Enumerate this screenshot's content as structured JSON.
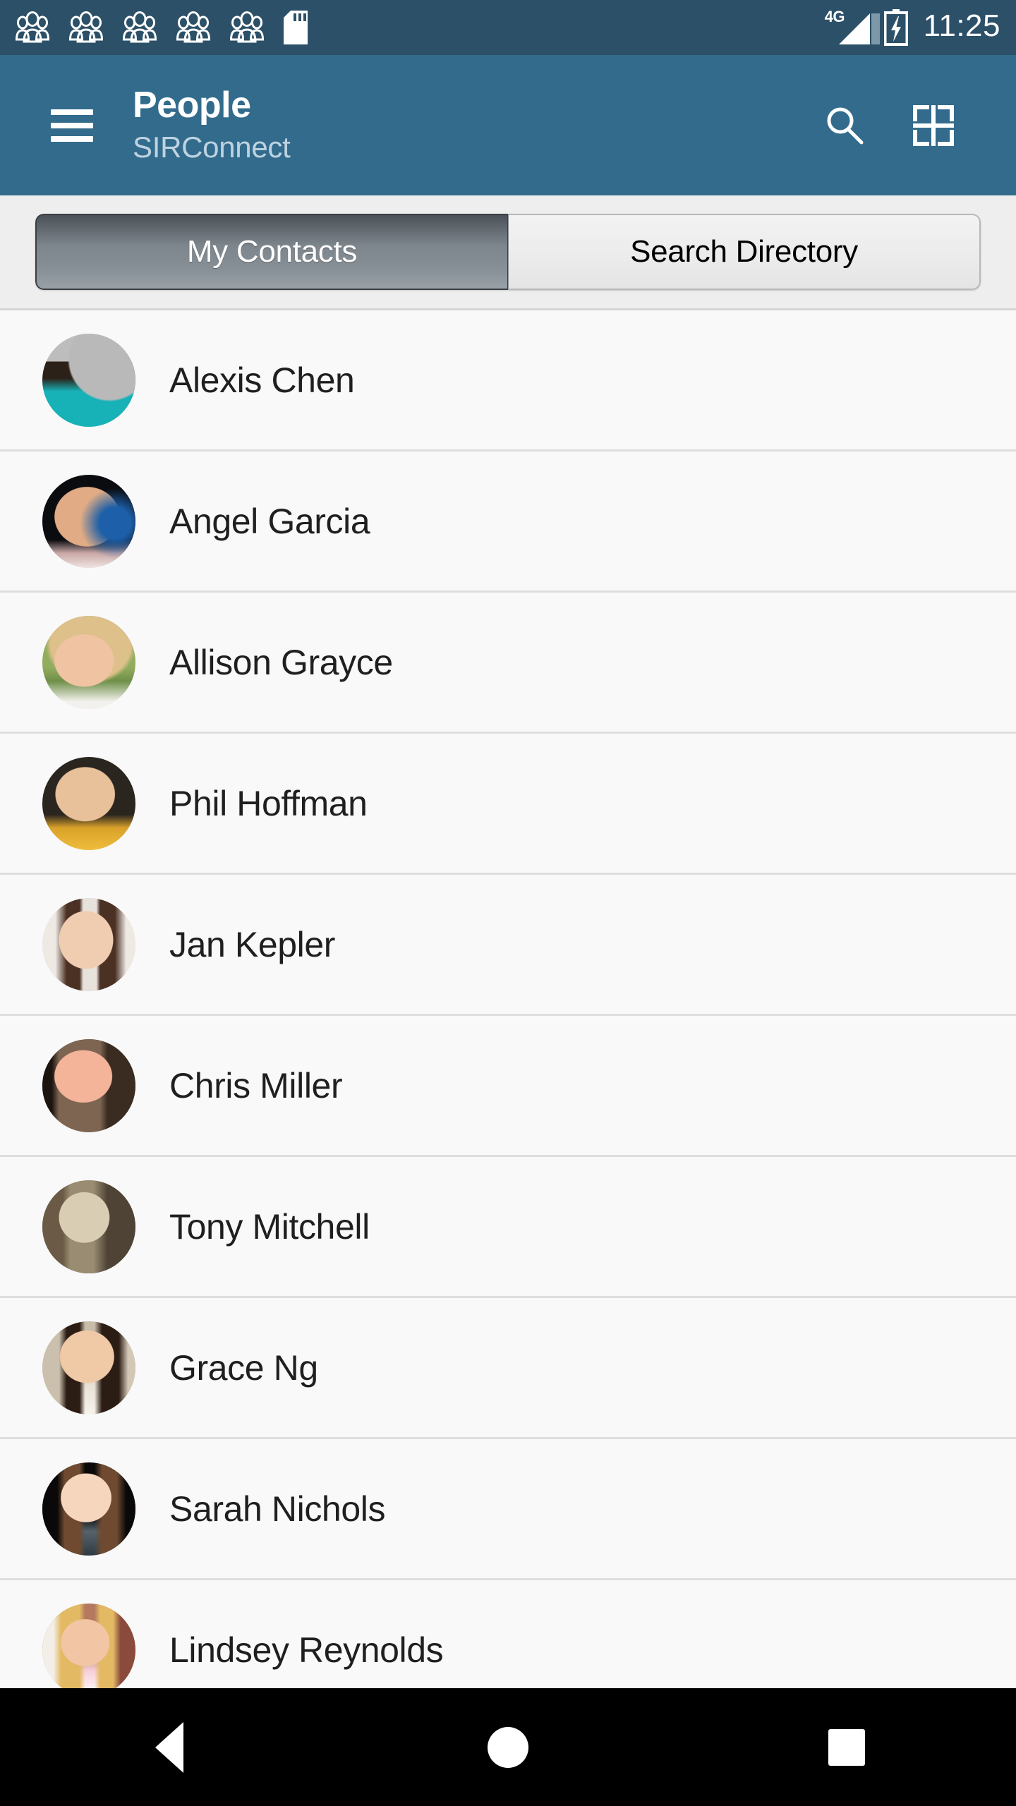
{
  "status_bar": {
    "notification_icons": [
      "people-group-icon",
      "people-group-icon",
      "people-group-icon",
      "people-group-icon",
      "people-group-icon",
      "sd-card-icon"
    ],
    "network_label": "4G",
    "signal_icon": "signal-bars-icon",
    "battery_icon": "battery-charging-icon",
    "time": "11:25",
    "background_color": "#2c5068"
  },
  "app_bar": {
    "menu_icon": "hamburger-menu-icon",
    "title": "People",
    "subtitle": "SIRConnect",
    "actions": [
      {
        "icon": "search-icon",
        "label": "Search"
      },
      {
        "icon": "add-grid-icon",
        "label": "Add"
      }
    ],
    "background_color": "#336b8c"
  },
  "tabs": {
    "items": [
      {
        "label": "My Contacts",
        "selected": true
      },
      {
        "label": "Search Directory",
        "selected": false
      }
    ]
  },
  "contacts": [
    {
      "name": "Alexis Chen",
      "avatar": "avatar-alexis-chen"
    },
    {
      "name": "Angel Garcia",
      "avatar": "avatar-angel-garcia"
    },
    {
      "name": "Allison Grayce",
      "avatar": "avatar-allison-grayce"
    },
    {
      "name": "Phil Hoffman",
      "avatar": "avatar-phil-hoffman"
    },
    {
      "name": "Jan Kepler",
      "avatar": "avatar-jan-kepler"
    },
    {
      "name": "Chris Miller",
      "avatar": "avatar-chris-miller"
    },
    {
      "name": "Tony Mitchell",
      "avatar": "avatar-tony-mitchell"
    },
    {
      "name": "Grace Ng",
      "avatar": "avatar-grace-ng"
    },
    {
      "name": "Sarah Nichols",
      "avatar": "avatar-sarah-nichols"
    },
    {
      "name": "Lindsey Reynolds",
      "avatar": "avatar-lindsey-reynolds"
    }
  ],
  "nav_bar": {
    "buttons": [
      {
        "icon": "back-triangle-icon",
        "label": "Back"
      },
      {
        "icon": "home-circle-icon",
        "label": "Home"
      },
      {
        "icon": "recents-square-icon",
        "label": "Recents"
      }
    ],
    "background_color": "#000000"
  }
}
